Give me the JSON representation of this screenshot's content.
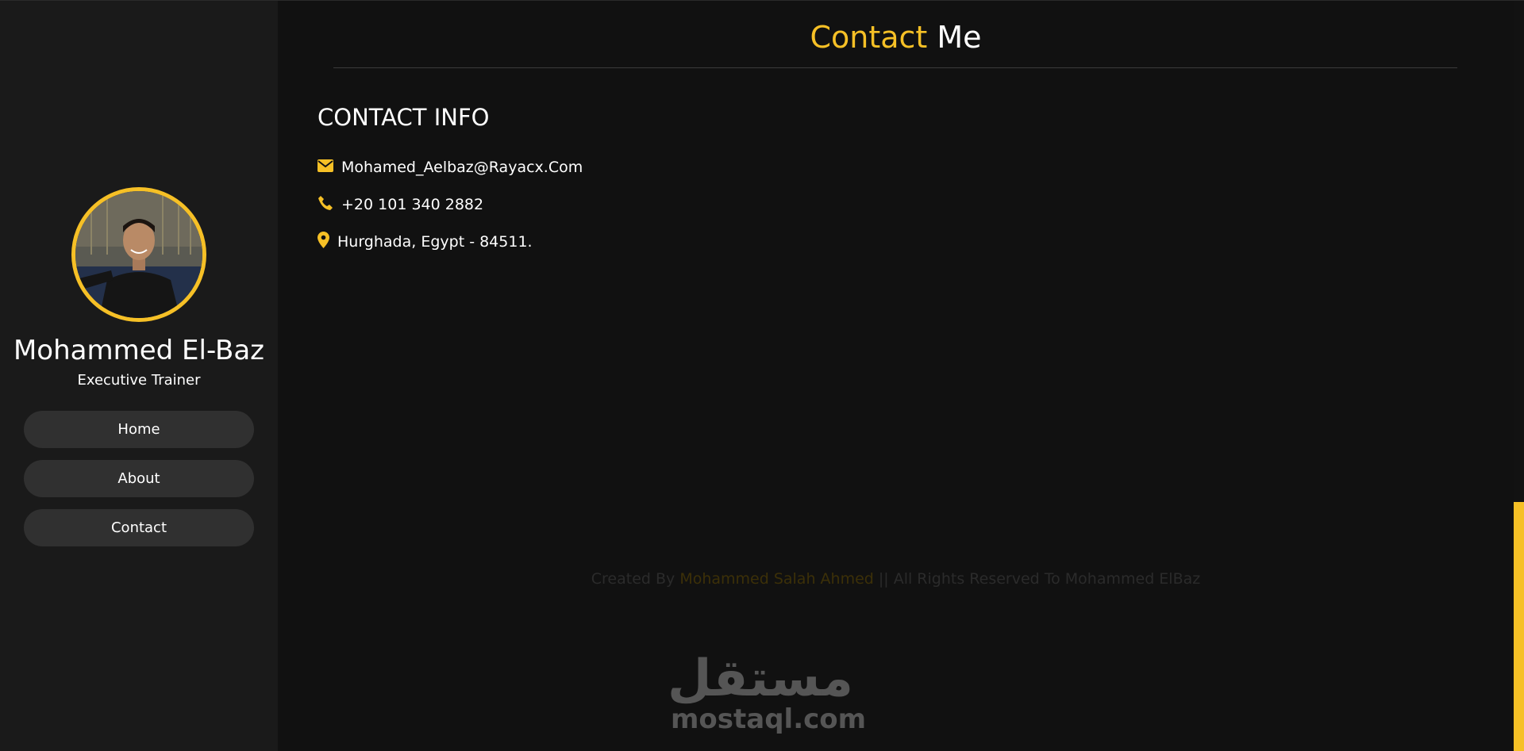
{
  "sidebar": {
    "name": "Mohammed El-Baz",
    "role": "Executive Trainer",
    "nav": [
      {
        "label": "Home"
      },
      {
        "label": "About"
      },
      {
        "label": "Contact"
      }
    ]
  },
  "main": {
    "title_accent": "Contact",
    "title_rest": " Me",
    "section_heading": "CONTACT INFO",
    "contact": {
      "email": "Mohamed_Aelbaz@Rayacx.Com",
      "phone": "+20 101 340 2882",
      "location": "Hurghada, Egypt - 84511."
    },
    "footer": {
      "prefix": "Created By ",
      "author": "Mohammed Salah Ahmed",
      "suffix": " || All Rights Reserved To Mohammed ElBaz"
    }
  },
  "watermark": {
    "arabic": "مستقل",
    "latin": "mostaql.com"
  },
  "icons": {
    "email": "envelope-icon",
    "phone": "phone-icon",
    "location": "map-marker-icon"
  },
  "colors": {
    "accent": "#f6c026",
    "background": "#111111",
    "sidebar": "#1a1a1a",
    "nav_button": "#303030"
  }
}
